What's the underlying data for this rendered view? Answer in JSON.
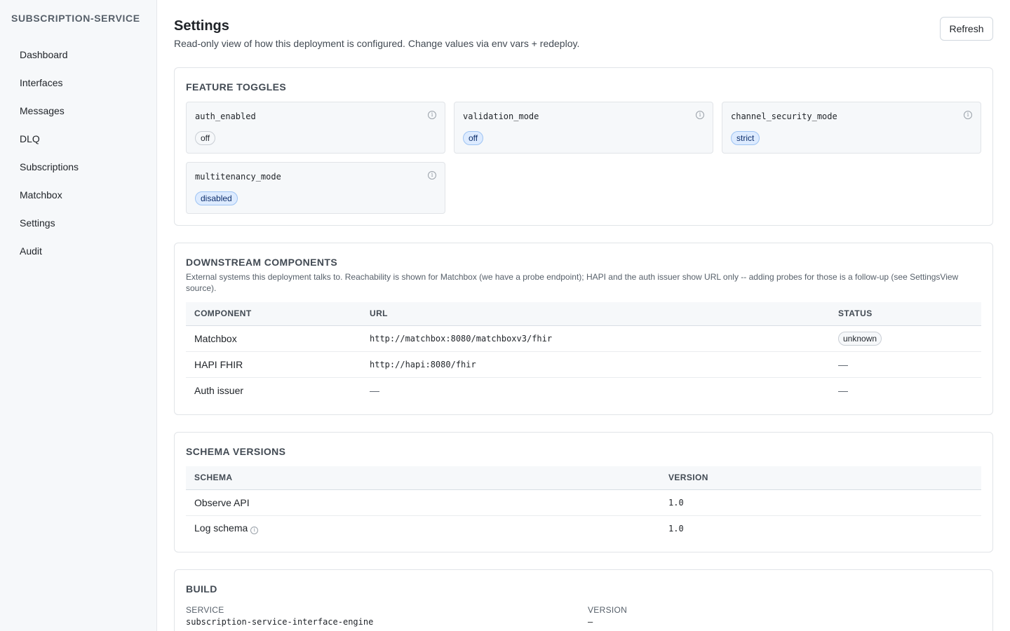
{
  "app": {
    "brand": "SUBSCRIPTION-SERVICE"
  },
  "sidebar": {
    "items": [
      {
        "label": "Dashboard"
      },
      {
        "label": "Interfaces"
      },
      {
        "label": "Messages"
      },
      {
        "label": "DLQ"
      },
      {
        "label": "Subscriptions"
      },
      {
        "label": "Matchbox"
      },
      {
        "label": "Settings"
      },
      {
        "label": "Audit"
      }
    ]
  },
  "header": {
    "title": "Settings",
    "subtitle": "Read-only view of how this deployment is configured. Change values via env vars + redeploy.",
    "refresh_label": "Refresh"
  },
  "feature_toggles": {
    "title": "FEATURE TOGGLES",
    "items": [
      {
        "name": "auth_enabled",
        "value": "off",
        "style": "gray",
        "icon": "info-icon"
      },
      {
        "name": "validation_mode",
        "value": "off",
        "style": "blue",
        "icon": "info-icon"
      },
      {
        "name": "channel_security_mode",
        "value": "strict",
        "style": "blue",
        "icon": "info-icon"
      },
      {
        "name": "multitenancy_mode",
        "value": "disabled",
        "style": "blue",
        "icon": "info-icon"
      }
    ]
  },
  "downstream": {
    "title": "DOWNSTREAM COMPONENTS",
    "description": "External systems this deployment talks to. Reachability is shown for Matchbox (we have a probe endpoint); HAPI and the auth issuer show URL only -- adding probes for those is a follow-up (see SettingsView source).",
    "columns": [
      "COMPONENT",
      "URL",
      "STATUS"
    ],
    "rows": [
      {
        "component": "Matchbox",
        "url": "http://matchbox:8080/matchboxv3/fhir",
        "status": "unknown"
      },
      {
        "component": "HAPI FHIR",
        "url": "http://hapi:8080/fhir",
        "status": "—"
      },
      {
        "component": "Auth issuer",
        "url": "—",
        "status": "—"
      }
    ]
  },
  "schema_versions": {
    "title": "SCHEMA VERSIONS",
    "columns": [
      "SCHEMA",
      "VERSION"
    ],
    "rows": [
      {
        "schema": "Observe API",
        "version": "1.0"
      },
      {
        "schema": "Log schema",
        "version": "1.0",
        "icon": "info-icon"
      }
    ]
  },
  "build": {
    "title": "BUILD",
    "service_label": "SERVICE",
    "service_value": "subscription-service-interface-engine",
    "version_label": "VERSION",
    "version_value": "—"
  },
  "colors": {
    "sidebar_bg": "#f6f8fa",
    "pill_blue_bg": "#ddebff",
    "pill_gray_bg": "#f6f8fa",
    "border": "#e1e4e8"
  }
}
